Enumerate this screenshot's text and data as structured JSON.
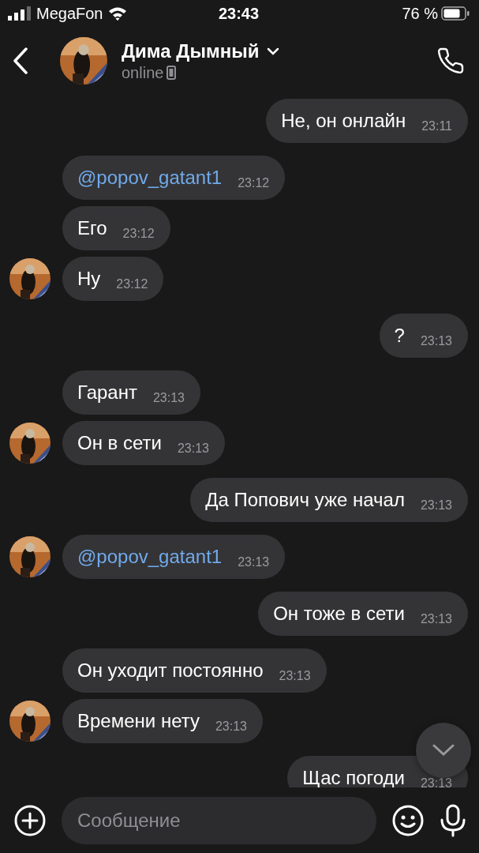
{
  "status_bar": {
    "carrier": "MegaFon",
    "time": "23:43",
    "battery": "76 %"
  },
  "header": {
    "name": "Дима Дымный",
    "status": "online"
  },
  "messages": [
    {
      "kind": "outgoing",
      "text": "Не, он онлайн",
      "time": "23:11",
      "link": false,
      "avatar": false
    },
    {
      "kind": "incoming",
      "text": "@popov_gatant1",
      "time": "23:12",
      "link": true,
      "avatar": false
    },
    {
      "kind": "incoming",
      "text": "Его",
      "time": "23:12",
      "link": false,
      "avatar": false
    },
    {
      "kind": "incoming",
      "text": "Ну",
      "time": "23:12",
      "link": false,
      "avatar": true
    },
    {
      "kind": "outgoing",
      "text": "?",
      "time": "23:13",
      "link": false,
      "avatar": false
    },
    {
      "kind": "incoming",
      "text": "Гарант",
      "time": "23:13",
      "link": false,
      "avatar": false
    },
    {
      "kind": "incoming",
      "text": "Он в сети",
      "time": "23:13",
      "link": false,
      "avatar": true
    },
    {
      "kind": "outgoing",
      "text": "Да Попович уже начал",
      "time": "23:13",
      "link": false,
      "avatar": false
    },
    {
      "kind": "incoming",
      "text": "@popov_gatant1",
      "time": "23:13",
      "link": true,
      "avatar": true
    },
    {
      "kind": "outgoing",
      "text": "Он тоже в сети",
      "time": "23:13",
      "link": false,
      "avatar": false
    },
    {
      "kind": "incoming",
      "text": "Он уходит постоянно",
      "time": "23:13",
      "link": false,
      "avatar": false
    },
    {
      "kind": "incoming",
      "text": "Времени нету",
      "time": "23:13",
      "link": false,
      "avatar": true
    },
    {
      "kind": "outgoing",
      "text": "Щас погоди",
      "time": "23:13",
      "link": false,
      "avatar": false
    }
  ],
  "composer": {
    "placeholder": "Сообщение"
  }
}
